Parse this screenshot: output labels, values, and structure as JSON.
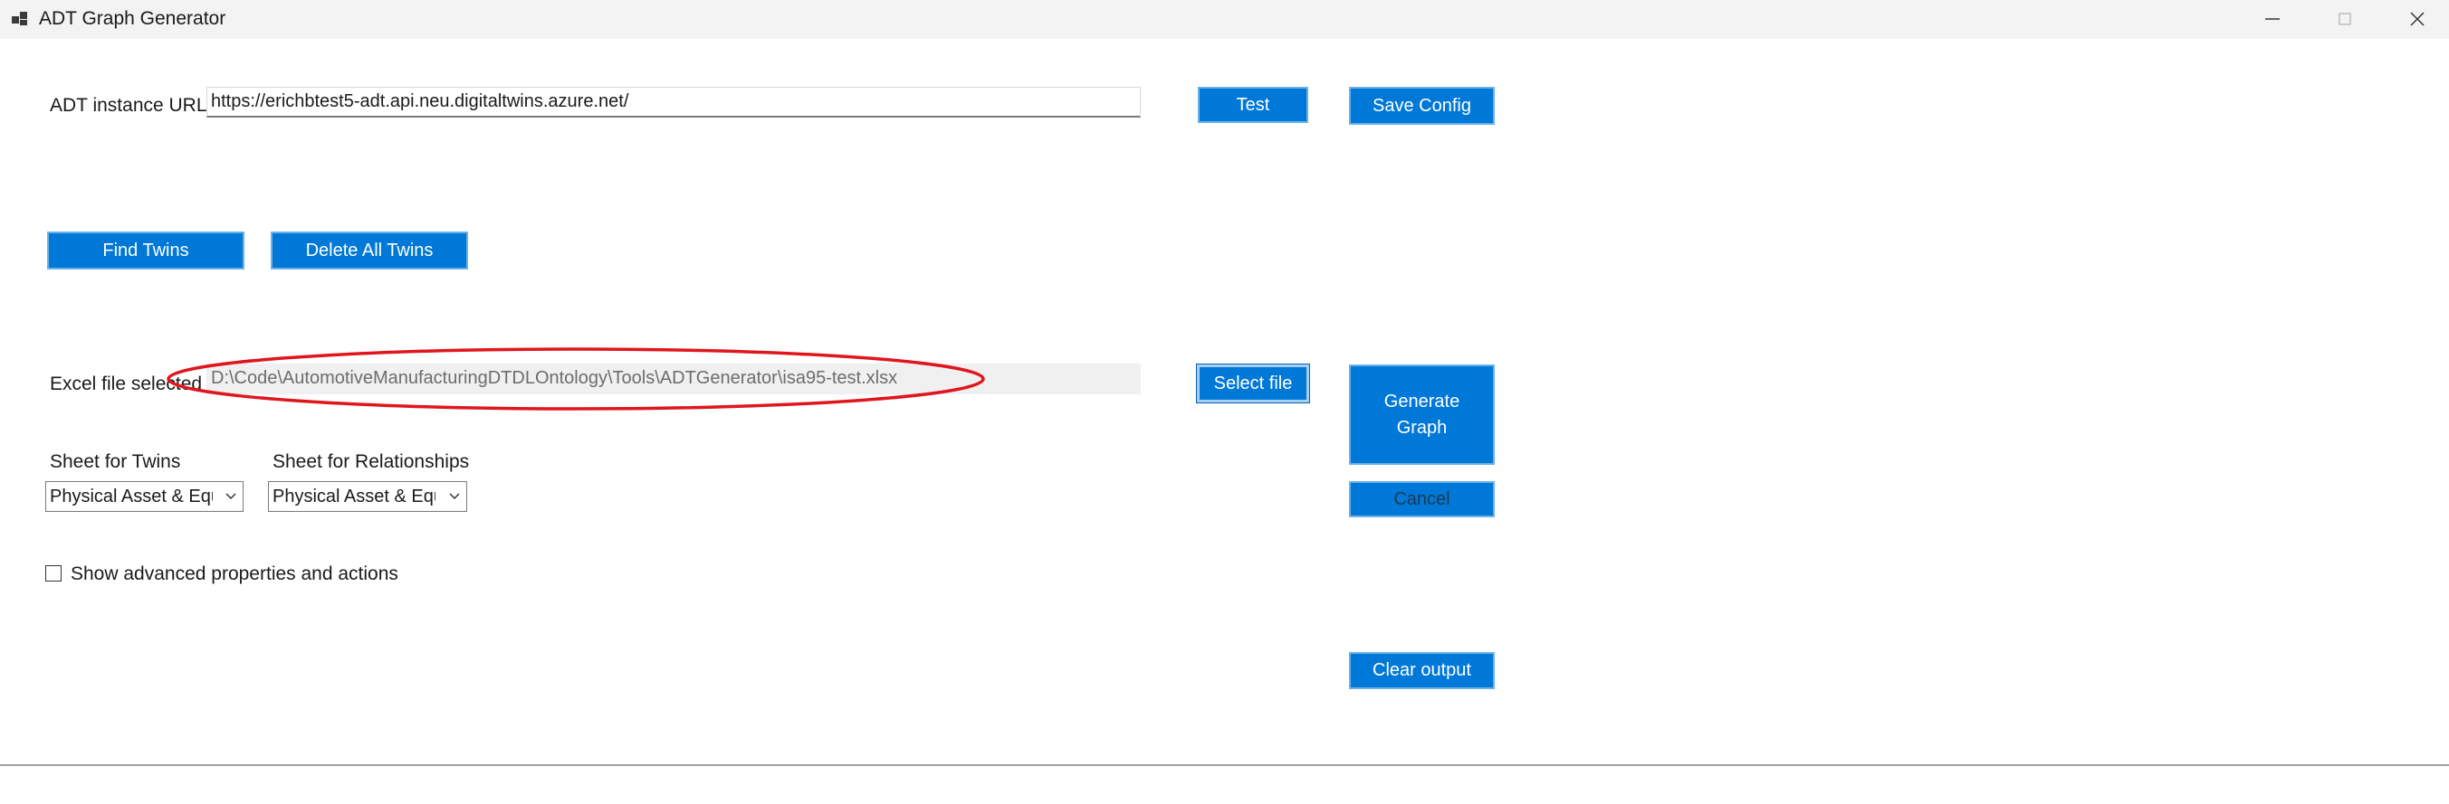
{
  "window": {
    "title": "ADT Graph Generator",
    "icons": {
      "app": "app-window-icon",
      "minimize": "minimize-icon",
      "maximize": "maximize-icon",
      "close": "close-icon"
    }
  },
  "config": {
    "url_label": "ADT instance URL",
    "url_value": "https://erichbtest5-adt.api.neu.digitaltwins.azure.net/",
    "test_label": "Test",
    "save_label": "Save Config"
  },
  "twins": {
    "find_label": "Find Twins",
    "delete_label": "Delete All Twins"
  },
  "excel": {
    "label": "Excel file selected",
    "path": "D:\\Code\\AutomotiveManufacturingDTDLOntology\\Tools\\ADTGenerator\\isa95-test.xlsx",
    "select_label": "Select file"
  },
  "sheets": {
    "twins_label": "Sheet for Twins",
    "twins_value": "Physical Asset & Equipment",
    "relationships_label": "Sheet for Relationships",
    "relationships_value": "Physical Asset & Equipment"
  },
  "actions": {
    "generate_label_line1": "Generate",
    "generate_label_line2": "Graph",
    "cancel_label": "Cancel",
    "clear_label": "Clear output"
  },
  "advanced": {
    "checkbox_label": "Show advanced properties and actions",
    "checked": false
  },
  "colors": {
    "button_blue": "#0078d7",
    "annotation_red": "#e0161e"
  }
}
